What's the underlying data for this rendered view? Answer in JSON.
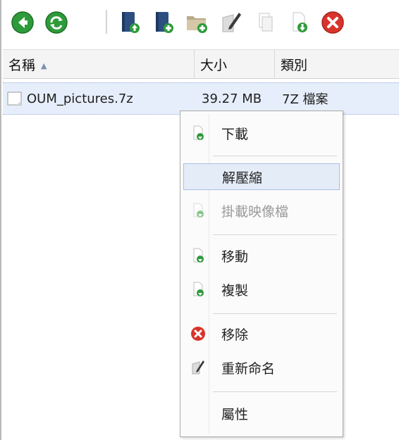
{
  "toolbar": {
    "buttons": [
      {
        "name": "back-button",
        "icon": "back-arrow-icon"
      },
      {
        "name": "refresh-button",
        "icon": "refresh-icon"
      },
      {
        "name": "upload-button",
        "icon": "upload-book-icon"
      },
      {
        "name": "new-file-button",
        "icon": "add-book-icon"
      },
      {
        "name": "new-folder-button",
        "icon": "add-folder-icon"
      },
      {
        "name": "rename-button",
        "icon": "rename-pen-icon"
      },
      {
        "name": "copy-button",
        "icon": "copy-page-icon"
      },
      {
        "name": "download-button",
        "icon": "download-page-icon"
      },
      {
        "name": "delete-button",
        "icon": "delete-icon"
      }
    ]
  },
  "columns": {
    "name": "名稱",
    "size": "大小",
    "type": "類別"
  },
  "file": {
    "name": "OUM_pictures.7z",
    "size": "39.27 MB",
    "type": "7Z 檔案"
  },
  "menu": {
    "items": [
      {
        "label": "下載",
        "icon": "download-page-icon",
        "disabled": false
      },
      {
        "label": "解壓縮",
        "icon": "",
        "disabled": false
      },
      {
        "label": "掛載映像檔",
        "icon": "mount-page-icon",
        "disabled": true
      },
      {
        "label": "移動",
        "icon": "move-page-icon",
        "disabled": false
      },
      {
        "label": "複製",
        "icon": "copy-page-icon",
        "disabled": false
      },
      {
        "label": "移除",
        "icon": "delete-icon",
        "disabled": false
      },
      {
        "label": "重新命名",
        "icon": "rename-pen-icon",
        "disabled": false
      },
      {
        "label": "屬性",
        "icon": "",
        "disabled": false
      }
    ]
  },
  "colors": {
    "accent_green": "#2e9b3a",
    "delete_red": "#d8342b",
    "selection_bg": "#e6eefb",
    "hover_border": "#a8bfe6"
  }
}
